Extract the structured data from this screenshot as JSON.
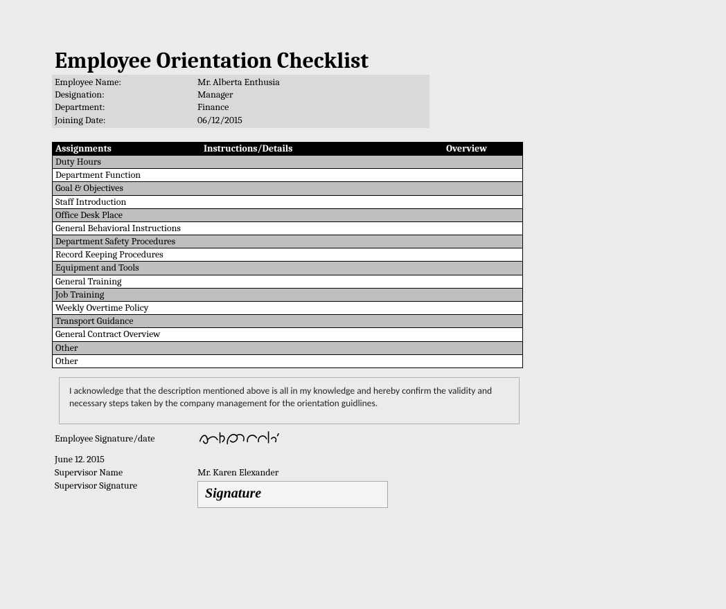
{
  "title": "Employee Orientation Checklist",
  "info": {
    "name_label": "Employee Name:",
    "name_value": "Mr. Alberta Enthusia",
    "designation_label": "Designation:",
    "designation_value": "Manager",
    "department_label": "Department:",
    "department_value": "Finance",
    "joining_label": "Joining Date:",
    "joining_value": "06/12/2015"
  },
  "table": {
    "headers": {
      "assignments": "Assignments",
      "instructions": "Instructions/Details",
      "overview": "Overview"
    },
    "rows": [
      "Duty Hours",
      "Department Function",
      "Goal & Objectives",
      "Staff Introduction",
      "Office Desk Place",
      "General Behavioral Instructions",
      "Department Safety Procedures",
      "Record Keeping Procedures",
      "Equipment and Tools",
      "General Training",
      "Job Training",
      "Weekly Overtime Policy",
      "Transport Guidance",
      "General Contract Overview",
      "Other",
      "Other"
    ]
  },
  "acknowledgment": "I acknowledge that the description mentioned above is all in my knowledge and hereby confirm the validity and necessary steps taken by the company management for the orientation guidlines.",
  "signatures": {
    "emp_sig_label": "Employee Signature/date",
    "emp_sig_date": "June 12. 2015",
    "sup_name_label": "Supervisor Name",
    "sup_name_value": "Mr. Karen Elexander",
    "sup_sig_label": "Supervisor Signature",
    "sup_sig_placeholder": "Signature"
  }
}
